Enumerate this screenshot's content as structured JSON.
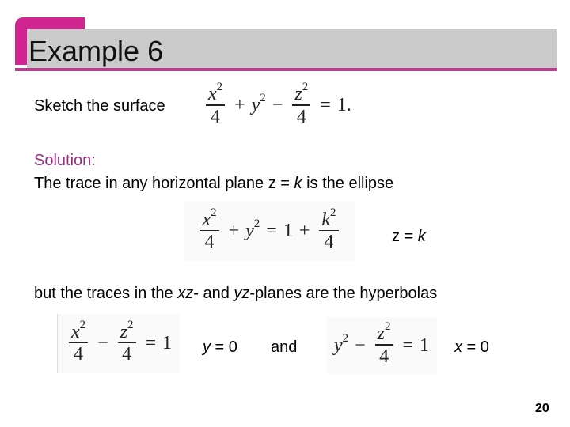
{
  "slide": {
    "title": "Example 6",
    "accent_color": "#d0268f",
    "title_bar_color": "#cbcbcb",
    "underline_color": "#b83f8e",
    "page_number": "20"
  },
  "problem": {
    "prompt": "Sketch the surface",
    "equation": {
      "term1_num": "x",
      "term1_exp": "2",
      "term1_den": "4",
      "op1": "+",
      "term2": "y",
      "term2_exp": "2",
      "op2": "−",
      "term3_num": "z",
      "term3_exp": "2",
      "term3_den": "4",
      "eq": "=",
      "rhs": "1."
    }
  },
  "solution": {
    "label": "Solution:",
    "label_color": "#9b2d7f",
    "line1_pre": "The trace in any horizontal plane z = ",
    "line1_var": "k",
    "line1_post": " is the ellipse",
    "ellipse": {
      "term1_num": "x",
      "term1_exp": "2",
      "term1_den": "4",
      "op1": "+",
      "term2": "y",
      "term2_exp": "2",
      "eq": "=",
      "one": "1",
      "op2": "+",
      "term3_num": "k",
      "term3_exp": "2",
      "term3_den": "4",
      "condition_pre": "z = ",
      "condition_var": "k"
    },
    "line2_pre": "but the traces in the ",
    "line2_xz": "xz",
    "line2_mid": "- and ",
    "line2_yz": "yz",
    "line2_post": "-planes are the hyperbolas",
    "hyperbola1": {
      "term1_num": "x",
      "term1_exp": "2",
      "term1_den": "4",
      "op": "−",
      "term2_num": "z",
      "term2_exp": "2",
      "term2_den": "4",
      "eq": "=",
      "rhs": "1",
      "condition_var": "y",
      "condition_post": " = 0"
    },
    "connector": "and",
    "hyperbola2": {
      "term1": "y",
      "term1_exp": "2",
      "op": "−",
      "term2_num": "z",
      "term2_exp": "2",
      "term2_den": "4",
      "eq": "=",
      "rhs": "1",
      "condition_var": "x",
      "condition_post": " = 0"
    }
  }
}
